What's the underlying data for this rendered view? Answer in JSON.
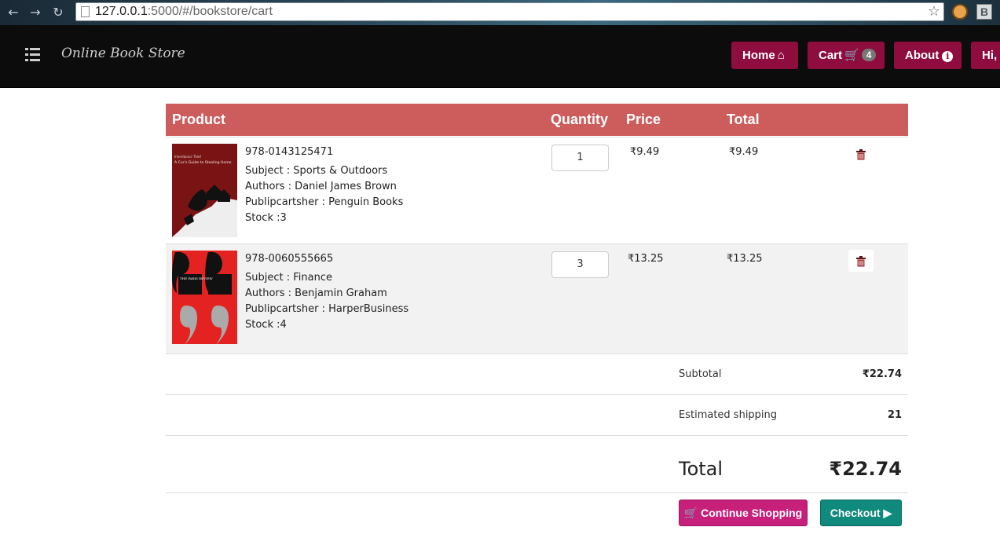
{
  "browser": {
    "url_host": "127.0.0.1",
    "url_path": ":5000/#/bookstore/cart",
    "extension_badge": "B"
  },
  "navbar": {
    "brand": "Online Book Store",
    "home_label": "Home",
    "cart_label": "Cart",
    "cart_count": "4",
    "about_label": "About",
    "user_label": "Hi,"
  },
  "table": {
    "headers": {
      "product": "Product",
      "quantity": "Quantity",
      "price": "Price",
      "total": "Total"
    }
  },
  "items": [
    {
      "isbn": "978-0143125471",
      "subject": "Subject : Sports & Outdoors",
      "authors": "Authors : Daniel James Brown",
      "publisher": "Publipcartsher : Penguin Books",
      "stock": "Stock :3",
      "quantity": "1",
      "price": "₹9.49",
      "total": "₹9.49",
      "cover_title": "A Cur's Guide to Stealing Home"
    },
    {
      "isbn": "978-0060555665",
      "subject": "Subject : Finance",
      "authors": "Authors : Benjamin Graham",
      "publisher": "Publipcartsher : HarperBusiness",
      "stock": "Stock :4",
      "quantity": "3",
      "price": "₹13.25",
      "total": "₹13.25",
      "cover_title": "THE PARIS REVIEW"
    }
  ],
  "summary": {
    "subtotal_label": "Subtotal",
    "subtotal_value": "₹22.74",
    "shipping_label": "Estimated shipping",
    "shipping_value": "21",
    "total_label": "Total",
    "total_value": "₹22.74"
  },
  "actions": {
    "continue_label": "Continue Shopping",
    "checkout_label": "Checkout"
  },
  "colors": {
    "nav_button": "#8e0c3e",
    "table_header": "#cd5c5c",
    "continue_button": "#c6207a",
    "checkout_button": "#0f8a7c"
  }
}
